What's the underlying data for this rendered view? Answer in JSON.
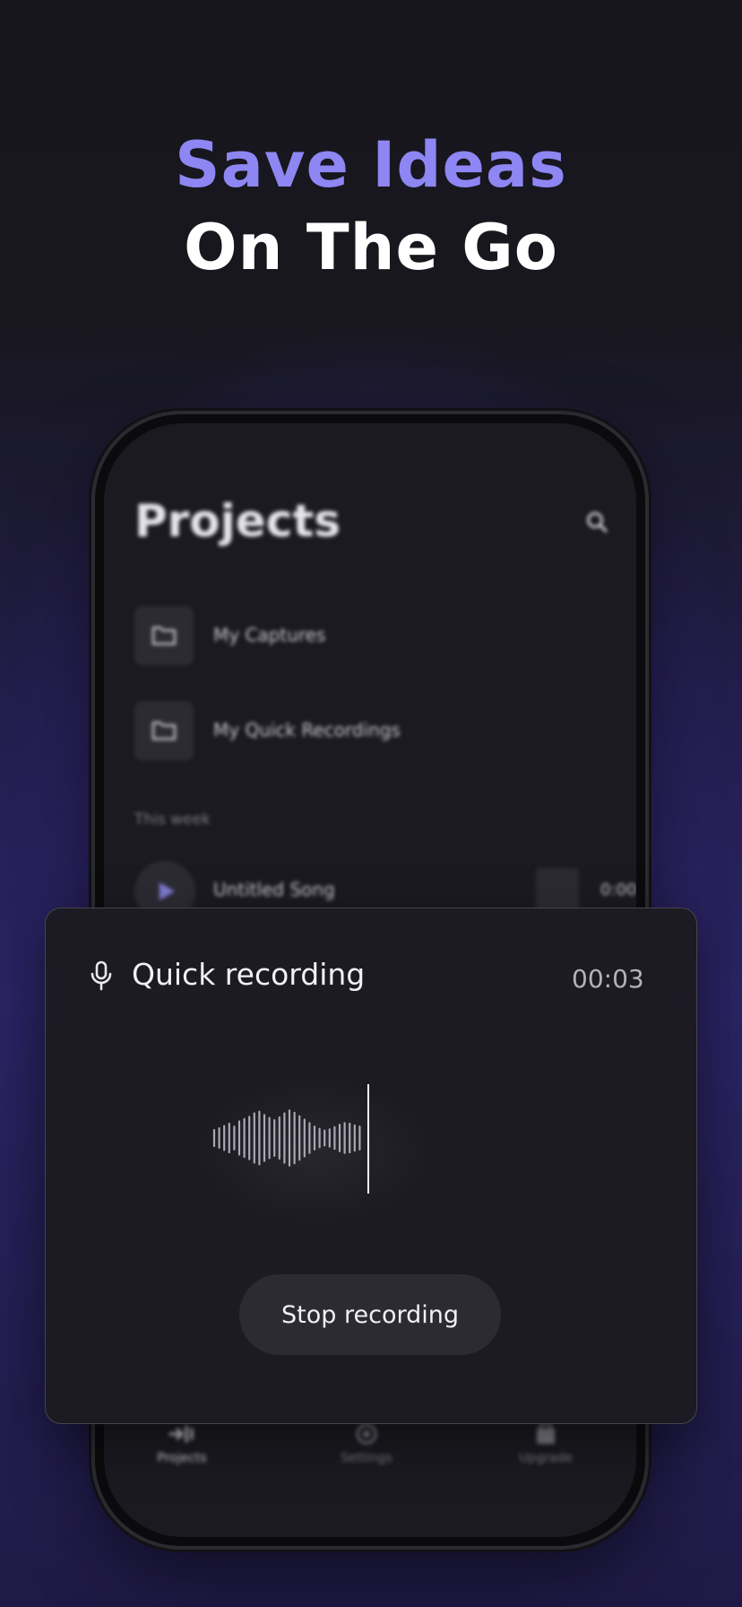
{
  "headline": {
    "line1": "Save Ideas",
    "line2": "On The Go"
  },
  "projects": {
    "title": "Projects",
    "folders": [
      {
        "label": "My Captures",
        "icon": "folder-icon"
      },
      {
        "label": "My Quick Recordings",
        "icon": "folder-icon"
      }
    ],
    "section_label": "This week",
    "songs": [
      {
        "title": "Untitled Song",
        "duration": "0:00"
      }
    ]
  },
  "tabbar": {
    "tabs": [
      {
        "label": "Projects",
        "icon": "projects-icon",
        "active": true
      },
      {
        "label": "Settings",
        "icon": "gear-icon",
        "active": false
      },
      {
        "label": "Upgrade",
        "icon": "upgrade-icon",
        "active": false
      }
    ]
  },
  "recording": {
    "title": "Quick recording",
    "timer": "00:03",
    "stop_label": "Stop recording",
    "waveform_levels": [
      0.28,
      0.34,
      0.42,
      0.5,
      0.4,
      0.58,
      0.66,
      0.74,
      0.86,
      0.92,
      0.8,
      0.7,
      0.62,
      0.72,
      0.86,
      0.96,
      0.88,
      0.76,
      0.64,
      0.52,
      0.4,
      0.32,
      0.26,
      0.3,
      0.38,
      0.46,
      0.52,
      0.5,
      0.44,
      0.4
    ]
  },
  "colors": {
    "accent": "#8d86f3",
    "background": "#16151d",
    "card": "#1c1b22",
    "button": "#2c2b32"
  }
}
